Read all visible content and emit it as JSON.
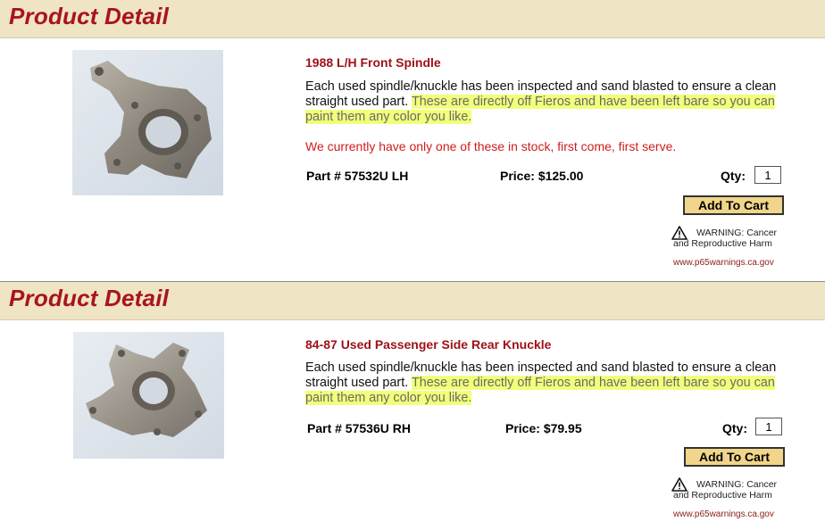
{
  "products": [
    {
      "header": "Product Detail",
      "title": "1988 L/H Front Spindle",
      "desc_plain": "Each used spindle/knuckle has been inspected and sand blasted to ensure a clean straight used part.",
      "desc_highlight": "These are directly off Fieros and have been left bare so you can paint them any color you like.",
      "stock_note": "We currently have only one of these in stock, first come, first serve.",
      "part": "Part # 57532U LH",
      "price_label": "Price:",
      "price": "$125.00",
      "qty_label": "Qty:",
      "qty_value": "1",
      "add_to_cart": "Add To Cart",
      "warning_line1": "WARNING: Cancer",
      "warning_line2": "and Reproductive Harm",
      "warning_link": "www.p65warnings.ca.gov",
      "image_name": "front-spindle-photo"
    },
    {
      "header": "Product Detail",
      "title": "84-87 Used Passenger Side Rear Knuckle",
      "desc_plain": "Each used spindle/knuckle has been inspected and sand blasted to ensure a clean straight used part.",
      "desc_highlight": "These are directly off Fieros and have been left bare so you can paint them any color you like.",
      "part": "Part # 57536U RH",
      "price_label": "Price:",
      "price": "$79.95",
      "qty_label": "Qty:",
      "qty_value": "1",
      "add_to_cart": "Add To Cart",
      "warning_line1": "WARNING: Cancer",
      "warning_line2": "and Reproductive Harm",
      "warning_link": "www.p65warnings.ca.gov",
      "image_name": "rear-knuckle-photo"
    }
  ],
  "colors": {
    "header_bg": "#efe4c4",
    "header_text": "#a8141d",
    "title_text": "#9e1018",
    "highlight": "#f2ff7a",
    "stock_text": "#d01c1c",
    "button_bg": "#f0d58a"
  },
  "icons": [
    "warning-triangle-icon"
  ]
}
